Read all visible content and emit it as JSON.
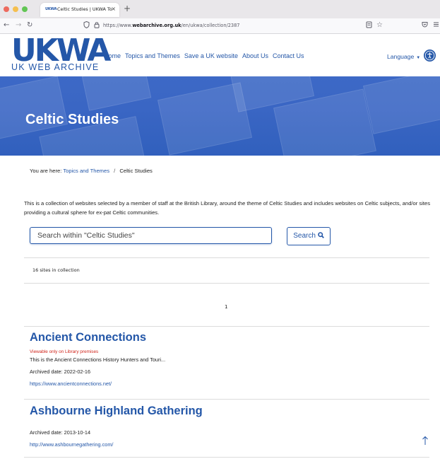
{
  "browser": {
    "tab_favicon": "UKWA",
    "tab_title": "Celtic Studies | UKWA Topics an",
    "tab_close": "×",
    "new_tab": "+",
    "back": "←",
    "forward": "→",
    "reload": "↻",
    "url_prefix": "https://www.",
    "url_domain": "webarchive.org.uk",
    "url_path": "/en/ukwa/collection/2387",
    "icons": [
      "shield-icon",
      "lock-icon",
      "reader-view-icon",
      "bookmark-star-icon",
      "pocket-icon",
      "menu-icon"
    ]
  },
  "header": {
    "logo_mark": "UKWA",
    "logo_sub": "UK WEB ARCHIVE",
    "nav": [
      "Home",
      "Topics and Themes",
      "Save a UK website",
      "About Us",
      "Contact Us"
    ],
    "language": "Language",
    "accessibility_icon": "accessibility-icon"
  },
  "banner": {
    "title": "Celtic Studies",
    "color": "#3a66c4"
  },
  "breadcrumb": {
    "prefix": "You are here:",
    "link": "Topics and Themes",
    "separator": "/",
    "current": "Celtic Studies"
  },
  "description": "This is a collection of websites selected by a member of staff at the British Library, around the theme of Celtic Studies and includes websites on Celtic subjects, and/or sites providing a cultural sphere for ex-pat Celtic communities.",
  "search": {
    "placeholder": "Search within \"Celtic Studies\"",
    "button_label": "Search",
    "button_icon": "search-icon"
  },
  "collection": {
    "count_text": "16 sites in collection",
    "page": "1"
  },
  "results": [
    {
      "title": "Ancient Connections",
      "note": "Viewable only on Library premises",
      "summary": "This is the Ancient Connections History Hunters and Touri...",
      "date": "Archived date: 2022-02-16",
      "url": "https://www.ancientconnections.net/"
    },
    {
      "title": "Ashbourne Highland Gathering",
      "date": "Archived date: 2013-10-14",
      "url": "http://www.ashbournegathering.com/"
    }
  ],
  "scroll_top_icon": "arrow-up-icon",
  "colors": {
    "brand": "#2457a8",
    "warning": "#d0251c"
  }
}
